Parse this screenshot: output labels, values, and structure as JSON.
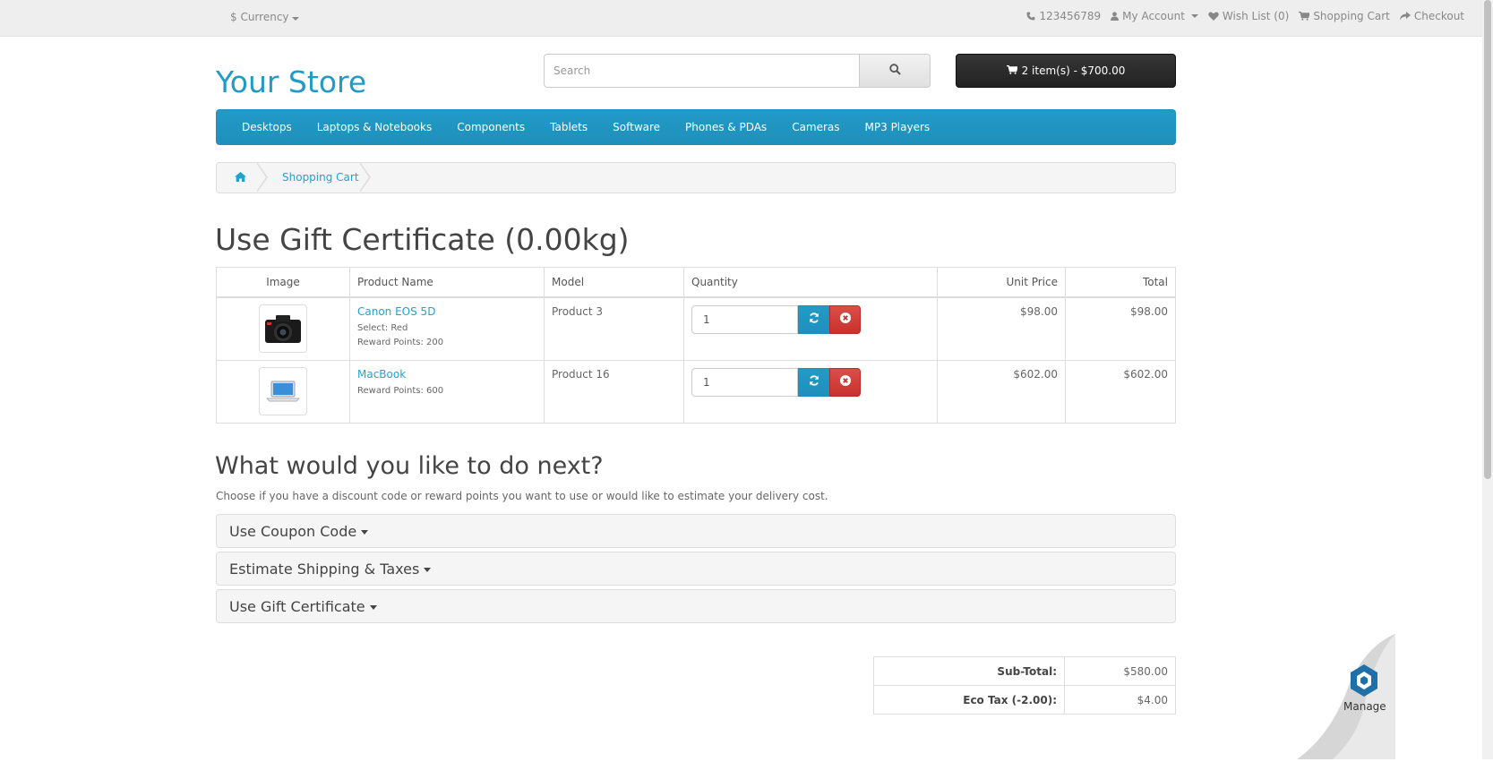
{
  "topbar": {
    "currency": "$ Currency",
    "phone": "123456789",
    "my_account": "My Account",
    "wishlist": "Wish List (0)",
    "shopping_cart": "Shopping Cart",
    "checkout": "Checkout"
  },
  "header": {
    "logo": "Your Store",
    "search_placeholder": "Search",
    "cart_button": "2 item(s) - $700.00"
  },
  "menu": [
    "Desktops",
    "Laptops & Notebooks",
    "Components",
    "Tablets",
    "Software",
    "Phones & PDAs",
    "Cameras",
    "MP3 Players"
  ],
  "breadcrumb": {
    "current": "Shopping Cart"
  },
  "page_title": "Use Gift Certificate  (0.00kg)",
  "cart": {
    "headers": {
      "image": "Image",
      "name": "Product Name",
      "model": "Model",
      "quantity": "Quantity",
      "unit_price": "Unit Price",
      "total": "Total"
    },
    "rows": [
      {
        "name": "Canon EOS 5D",
        "option": "Select: Red",
        "reward": "Reward Points: 200",
        "model": "Product 3",
        "quantity": "1",
        "unit_price": "$98.00",
        "total": "$98.00",
        "image_icon": "camera-icon"
      },
      {
        "name": "MacBook",
        "option": "",
        "reward": "Reward Points: 600",
        "model": "Product 16",
        "quantity": "1",
        "unit_price": "$602.00",
        "total": "$602.00",
        "image_icon": "laptop-icon"
      }
    ]
  },
  "next": {
    "heading": "What would you like to do next?",
    "description": "Choose if you have a discount code or reward points you want to use or would like to estimate your delivery cost.",
    "panels": [
      "Use Coupon Code",
      "Estimate Shipping & Taxes",
      "Use Gift Certificate"
    ]
  },
  "totals": [
    {
      "label": "Sub-Total:",
      "value": "$580.00"
    },
    {
      "label": "Eco Tax (-2.00):",
      "value": "$4.00"
    }
  ],
  "widget": {
    "label": "Manage"
  },
  "colors": {
    "brand_blue": "#229ac8",
    "link": "#23a1d1",
    "danger": "#da4f49",
    "cart_button": "#222222"
  }
}
